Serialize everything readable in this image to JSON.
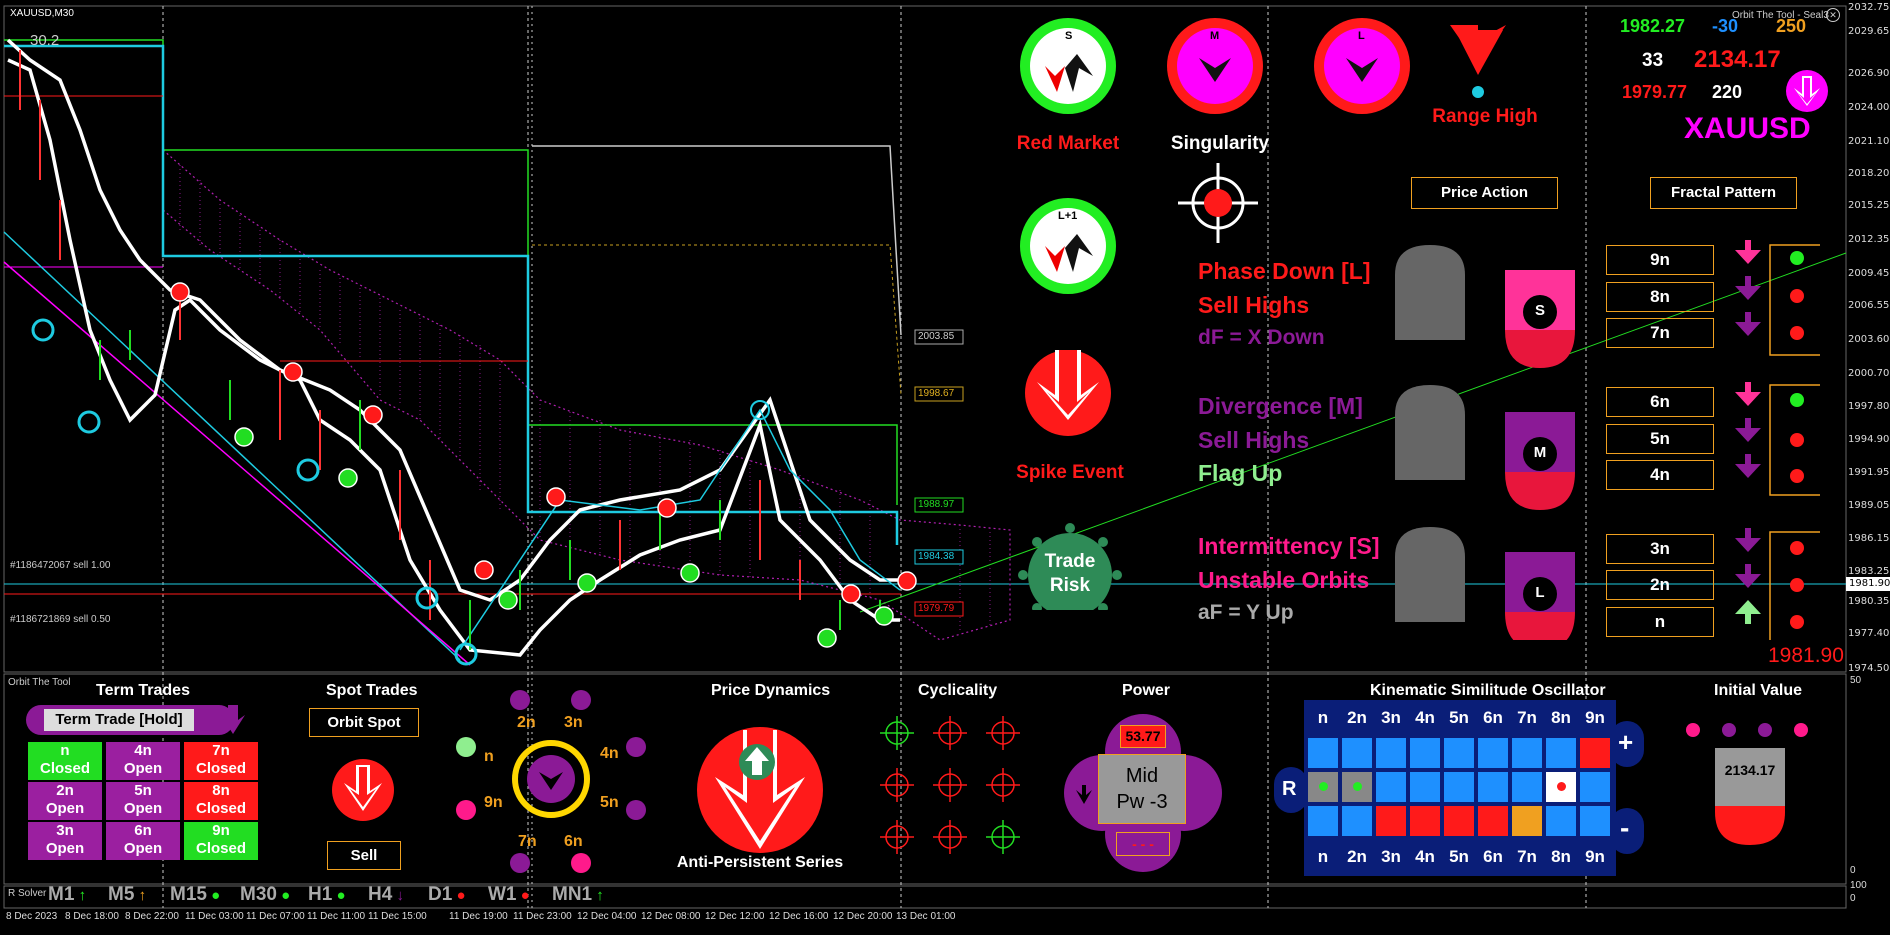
{
  "window": {
    "symbol_tf": "XAUUSD,M30",
    "indicator_title": "Orbit The Tool - Seal3",
    "panel_label": "Orbit The Tool",
    "subpanel_label": "R Solver",
    "top_left_value": "30.2",
    "bottom_right_price": "1981.90",
    "subscale_top": "100",
    "subscale_bottom": "0",
    "subscale_low": "50"
  },
  "price_scale": [
    "2032.75",
    "2029.65",
    "2026.90",
    "2024.00",
    "2021.10",
    "2018.20",
    "2015.25",
    "2012.35",
    "2009.45",
    "2006.55",
    "2003.60",
    "2000.70",
    "1997.80",
    "1994.90",
    "1991.95",
    "1989.05",
    "1986.15",
    "1983.25",
    "1981.90",
    "1980.35",
    "1977.40",
    "1974.50"
  ],
  "time_axis": [
    "8 Dec 2023",
    "8 Dec 18:00",
    "8 Dec 22:00",
    "11 Dec 03:00",
    "11 Dec 07:00",
    "11 Dec 11:00",
    "11 Dec 15:00",
    "11 Dec 19:00",
    "11 Dec 23:00",
    "12 Dec 04:00",
    "12 Dec 08:00",
    "12 Dec 12:00",
    "12 Dec 16:00",
    "12 Dec 20:00",
    "13 Dec 01:00"
  ],
  "chart_labels": {
    "order1": "#1186472067 sell 1.00",
    "order2": "#1186721869 sell 0.50",
    "lvl1": "2003.85",
    "lvl2": "1998.67",
    "lvl3": "1988.97",
    "lvl4": "1984.38",
    "lvl5": "1979.79"
  },
  "top_stats": {
    "v1": "1982.27",
    "v2": "-30",
    "v3": "250",
    "v4": "33",
    "v5": "2134.17",
    "v6": "1979.77",
    "v7": "220",
    "symbol": "XAUUSD"
  },
  "dials": {
    "s": "S",
    "m": "M",
    "l": "L",
    "l1": "L+1",
    "red_market": "Red Market",
    "singularity": "Singularity",
    "range_high": "Range High",
    "spike_event": "Spike Event",
    "trade_risk_1": "Trade",
    "trade_risk_2": "Risk"
  },
  "buttons": {
    "price_action": "Price Action",
    "fractal_pattern": "Fractal Pattern"
  },
  "phase_text": {
    "l1": "Phase Down [L]",
    "l2": "Sell Highs",
    "l3": "dF = X Down",
    "m1": "Divergence [M]",
    "m2": "Sell Highs",
    "m3": "Flag Up",
    "s1": "Intermittency [S]",
    "s2": "Unstable Orbits",
    "s3": "aF = Y Up"
  },
  "orbit_tags": {
    "s": "S",
    "m": "M",
    "l": "L"
  },
  "n_boxes": [
    "9n",
    "8n",
    "7n",
    "6n",
    "5n",
    "4n",
    "3n",
    "2n",
    "n"
  ],
  "term_trades": {
    "title": "Term Trades",
    "hold_btn": "Term Trade [Hold]",
    "cells": [
      {
        "a": "n",
        "b": "Closed",
        "bg": "#22dd22"
      },
      {
        "a": "4n",
        "b": "Open",
        "bg": "#9b1fa0"
      },
      {
        "a": "7n",
        "b": "Closed",
        "bg": "#ff1a1a"
      },
      {
        "a": "2n",
        "b": "Open",
        "bg": "#9b1fa0"
      },
      {
        "a": "5n",
        "b": "Open",
        "bg": "#9b1fa0"
      },
      {
        "a": "8n",
        "b": "Closed",
        "bg": "#ff1a1a"
      },
      {
        "a": "3n",
        "b": "Open",
        "bg": "#9b1fa0"
      },
      {
        "a": "6n",
        "b": "Open",
        "bg": "#9b1fa0"
      },
      {
        "a": "9n",
        "b": "Closed",
        "bg": "#22dd22"
      }
    ]
  },
  "spot_trades": {
    "title": "Spot Trades",
    "orbit_spot": "Orbit Spot",
    "sell": "Sell"
  },
  "orbit_ring": {
    "n2": "2n",
    "n3": "3n",
    "n4": "4n",
    "n5": "5n",
    "n6": "6n",
    "n7": "7n",
    "n9": "9n",
    "n1": "n"
  },
  "price_dynamics": {
    "title": "Price Dynamics",
    "caption": "Anti-Persistent Series"
  },
  "cyclicality": {
    "title": "Cyclicality"
  },
  "power": {
    "title": "Power",
    "value": "53.77",
    "mid1": "Mid",
    "mid2": "Pw -3",
    "dash": "- - -"
  },
  "kso": {
    "title": "Kinematic Similitude Oscillator",
    "headers": [
      "n",
      "2n",
      "3n",
      "4n",
      "5n",
      "6n",
      "7n",
      "8n",
      "9n"
    ],
    "r": "R",
    "plus": "+",
    "minus": "-"
  },
  "initial_value": {
    "title": "Initial Value",
    "value": "2134.17"
  },
  "timeframes": [
    "M1",
    "M5",
    "M15",
    "M30",
    "H1",
    "H4",
    "D1",
    "W1",
    "MN1"
  ],
  "colors": {
    "green": "#22ee22",
    "red": "#ff1a1a",
    "magenta": "#ff00ff",
    "purple": "#8b1a96",
    "orange": "#f0a020",
    "cyan": "#1ecbe1"
  }
}
